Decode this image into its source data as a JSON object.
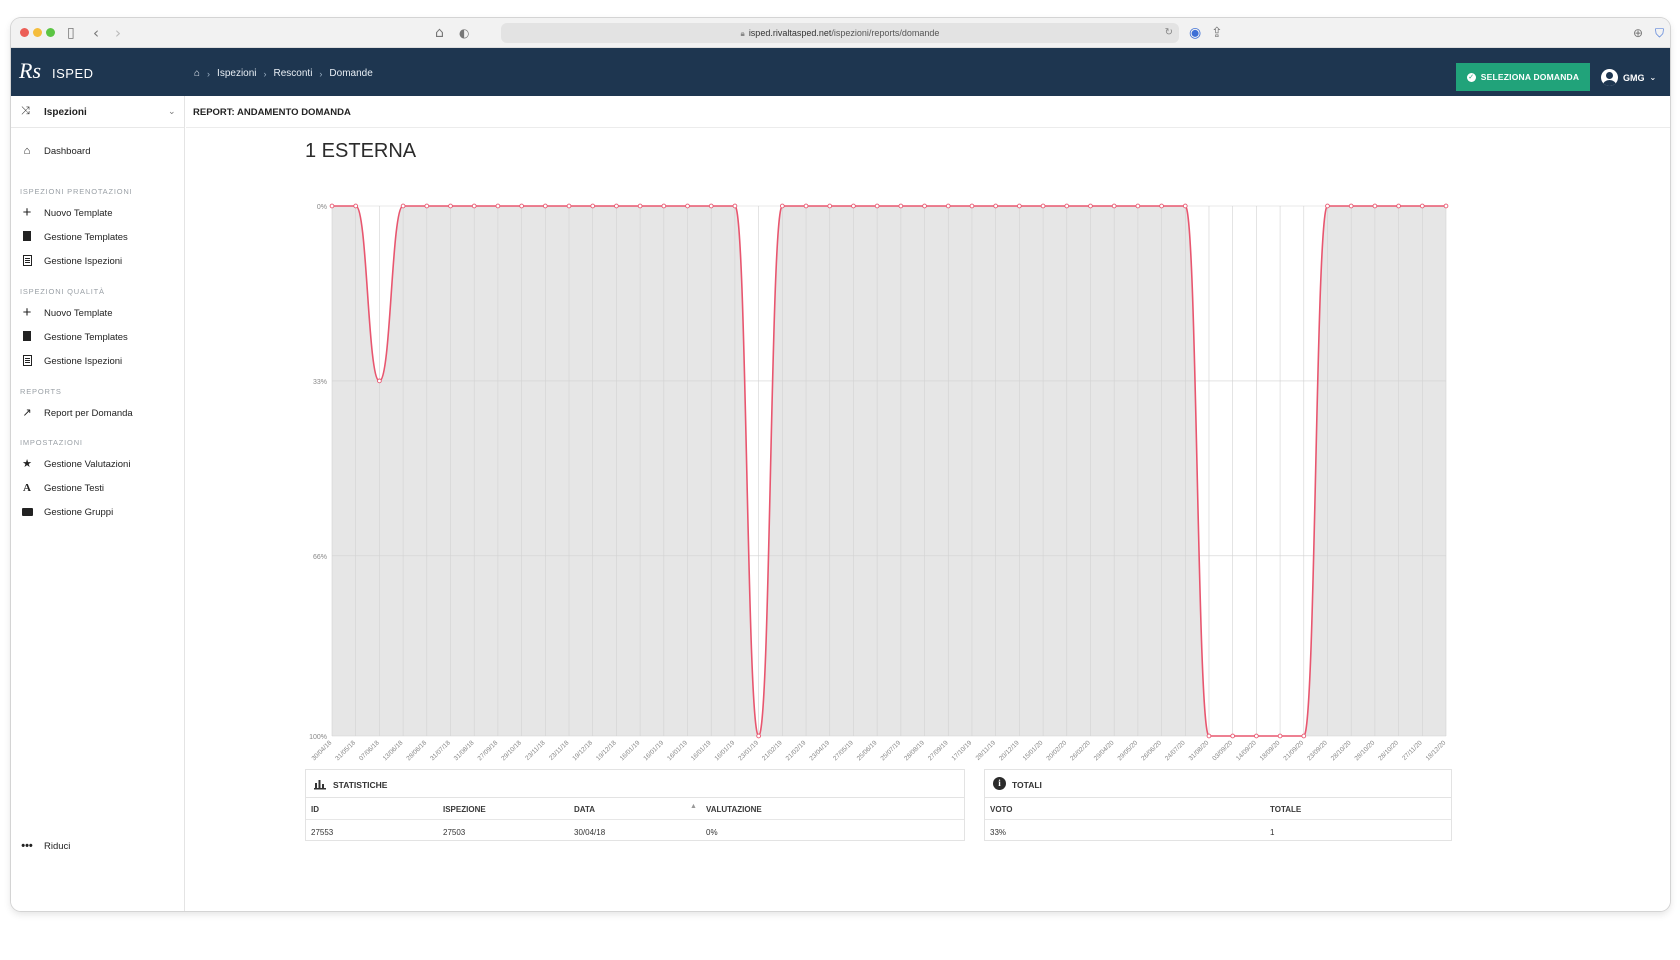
{
  "browser": {
    "url_domain": "isped.rivaltasped.net",
    "url_path": "/ispezioni/reports/domande"
  },
  "app": {
    "logo": "Rs",
    "name": "ISPED",
    "breadcrumb": [
      "Ispezioni",
      "Resconti",
      "Domande"
    ],
    "select_button": "SELEZIONA DOMANDA",
    "user": "GMG"
  },
  "sidebar": {
    "module": "Ispezioni",
    "dashboard": "Dashboard",
    "section_prenotazioni": "ISPEZIONI PRENOTAZIONI",
    "pren_items": [
      "Nuovo Template",
      "Gestione Templates",
      "Gestione Ispezioni"
    ],
    "section_qualita": "ISPEZIONI QUALITÀ",
    "qual_items": [
      "Nuovo Template",
      "Gestione Templates",
      "Gestione Ispezioni"
    ],
    "section_reports": "REPORTS",
    "report_item": "Report per Domanda",
    "section_impostazioni": "IMPOSTAZIONI",
    "imp_items": [
      "Gestione Valutazioni",
      "Gestione Testi",
      "Gestione Gruppi"
    ],
    "collapse": "Riduci"
  },
  "page": {
    "header": "REPORT: ANDAMENTO DOMANDA",
    "question_title": "1 ESTERNA"
  },
  "chart_data": {
    "type": "line",
    "line_color": "#e8566f",
    "fill_color": "#e6e6e6",
    "y_axis_reversed": true,
    "ylim": [
      0,
      100
    ],
    "y_tick_labels": [
      "0%",
      "33%",
      "66%",
      "100%"
    ],
    "y_tick_values": [
      0,
      33,
      66,
      100
    ],
    "x": [
      "30/04/18",
      "31/05/18",
      "07/06/18",
      "13/06/18",
      "28/06/18",
      "31/07/18",
      "31/08/18",
      "27/09/18",
      "29/10/18",
      "23/11/18",
      "23/11/18",
      "19/12/18",
      "19/12/18",
      "16/01/19",
      "16/01/19",
      "16/01/19",
      "16/01/19",
      "16/01/19",
      "23/01/19",
      "21/02/19",
      "21/02/19",
      "23/04/19",
      "27/05/19",
      "25/06/19",
      "25/07/19",
      "28/08/19",
      "27/09/19",
      "17/10/19",
      "28/11/19",
      "20/12/19",
      "15/01/20",
      "20/02/20",
      "26/02/20",
      "29/04/20",
      "29/05/20",
      "26/06/20",
      "24/07/20",
      "31/08/20",
      "03/09/20",
      "14/09/20",
      "18/09/20",
      "21/09/20",
      "23/09/20",
      "28/10/20",
      "28/10/20",
      "28/10/20",
      "27/11/20",
      "18/12/20"
    ],
    "y": [
      0,
      0,
      33,
      0,
      0,
      0,
      0,
      0,
      0,
      0,
      0,
      0,
      0,
      0,
      0,
      0,
      0,
      0,
      100,
      0,
      0,
      0,
      0,
      0,
      0,
      0,
      0,
      0,
      0,
      0,
      0,
      0,
      0,
      0,
      0,
      0,
      0,
      100,
      100,
      100,
      100,
      100,
      0,
      0,
      0,
      0,
      0,
      0
    ],
    "grid": true
  },
  "stats": {
    "title": "STATISTICHE",
    "columns": [
      "ID",
      "ISPEZIONE",
      "DATA",
      "VALUTAZIONE"
    ],
    "rows": [
      [
        "27553",
        "27503",
        "30/04/18",
        "0%"
      ]
    ]
  },
  "totals": {
    "title": "TOTALI",
    "columns": [
      "VOTO",
      "TOTALE"
    ],
    "rows": [
      [
        "33%",
        "1"
      ]
    ]
  }
}
